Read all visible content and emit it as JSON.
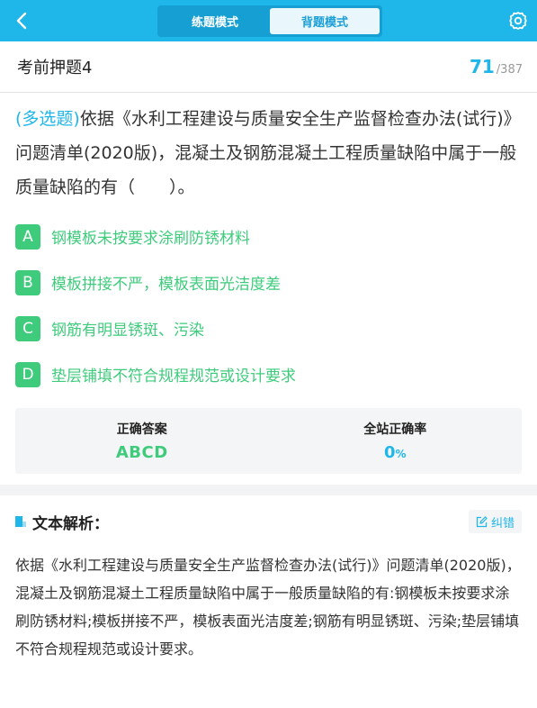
{
  "topbar": {
    "modes": [
      {
        "label": "练题模式",
        "active": false
      },
      {
        "label": "背题模式",
        "active": true
      }
    ]
  },
  "header": {
    "paper_title": "考前押题4",
    "current": "71",
    "total": "/387"
  },
  "question": {
    "type_label": "(多选题)",
    "text": "依据《水利工程建设与质量安全生产监督检查办法(试行)》问题清单(2020版)，混凝土及钢筋混凝土工程质量缺陷中属于一般质量缺陷的有（　　）。"
  },
  "options": [
    {
      "letter": "A",
      "text": "钢模板未按要求涂刷防锈材料"
    },
    {
      "letter": "B",
      "text": "模板拼接不严，模板表面光洁度差"
    },
    {
      "letter": "C",
      "text": "钢筋有明显锈斑、污染"
    },
    {
      "letter": "D",
      "text": "垫层铺填不符合规程规范或设计要求"
    }
  ],
  "answer": {
    "correct_label": "正确答案",
    "correct_value": "ABCD",
    "rate_label": "全站正确率",
    "rate_value": "0",
    "rate_unit": "%"
  },
  "analysis": {
    "title": "文本解析：",
    "report_label": "纠错",
    "text": "依据《水利工程建设与质量安全生产监督检查办法(试行)》问题清单(2020版)，混凝土及钢筋混凝土工程质量缺陷中属于一般质量缺陷的有:钢模板未按要求涂刷防锈材料;模板拼接不严，模板表面光洁度差;钢筋有明显锈斑、污染;垫层铺填不符合规程规范或设计要求。"
  },
  "colors": {
    "brand": "#1fb6ea",
    "correct": "#3ecb7c"
  }
}
